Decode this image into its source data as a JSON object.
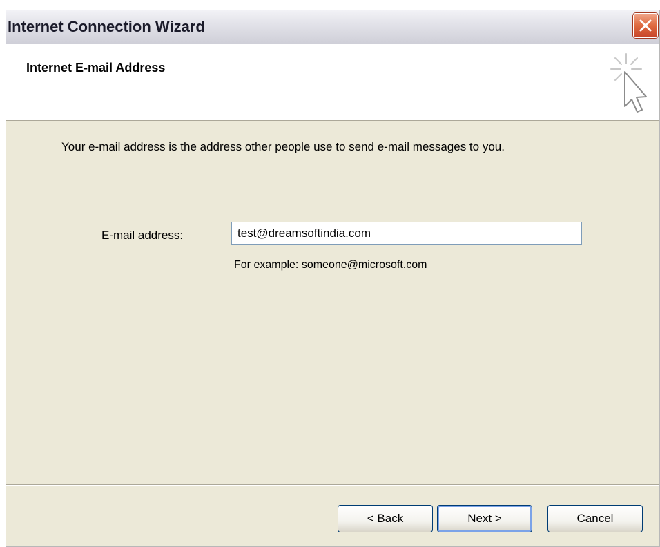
{
  "window": {
    "title": "Internet Connection Wizard",
    "close_icon": "close-icon"
  },
  "header": {
    "title": "Internet E-mail Address",
    "icon": "wizard-cursor-icon"
  },
  "content": {
    "intro": "Your e-mail address is the address other people use to send e-mail messages to you.",
    "email_label": "E-mail address:",
    "email_value": "test@dreamsoftindia.com",
    "example": "For example: someone@microsoft.com"
  },
  "buttons": {
    "back": "< Back",
    "next": "Next >",
    "cancel": "Cancel"
  },
  "colors": {
    "dialog_bg": "#ece9d8",
    "close_red": "#df6a3f",
    "button_border": "#003c74"
  }
}
